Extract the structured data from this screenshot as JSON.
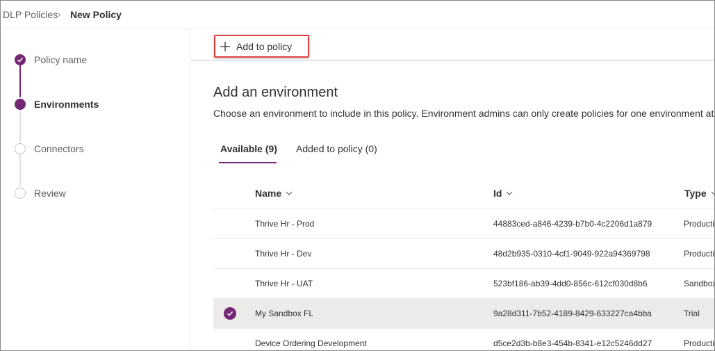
{
  "breadcrumb": {
    "root": "DLP Policies",
    "separator": "›",
    "current": "New Policy"
  },
  "steps": [
    {
      "label": "Policy name",
      "status": "completed"
    },
    {
      "label": "Environments",
      "status": "active"
    },
    {
      "label": "Connectors",
      "status": "pending"
    },
    {
      "label": "Review",
      "status": "pending"
    }
  ],
  "command_bar": {
    "add_label": "Add to policy"
  },
  "main": {
    "title": "Add an environment",
    "description": "Choose an environment to include in this policy. Environment admins can only create policies for one environment at"
  },
  "tabs": [
    {
      "label": "Available (9)",
      "selected": true
    },
    {
      "label": "Added to policy (0)",
      "selected": false
    }
  ],
  "table": {
    "columns": [
      "Name",
      "Id",
      "Type"
    ],
    "rows": [
      {
        "name": "Thrive Hr - Prod",
        "id": "44883ced-a846-4239-b7b0-4c2206d1a879",
        "type": "Production",
        "selected": false
      },
      {
        "name": "Thrive Hr - Dev",
        "id": "48d2b935-0310-4cf1-9049-922a94369798",
        "type": "Production",
        "selected": false
      },
      {
        "name": "Thrive Hr - UAT",
        "id": "523bf186-ab39-4dd0-856c-612cf030d8b6",
        "type": "Sandbox",
        "selected": false
      },
      {
        "name": "My Sandbox FL",
        "id": "9a28d311-7b52-4189-8429-633227ca4bba",
        "type": "Trial",
        "selected": true
      },
      {
        "name": "Device Ordering Development",
        "id": "d5ce2d3b-b8e3-454b-8341-e12c5246dd27",
        "type": "Production",
        "selected": false
      }
    ]
  },
  "colors": {
    "accent": "#742774",
    "highlight_border": "#e04040",
    "selected_row": "#edebe9"
  },
  "icons": {
    "add": "plus-icon",
    "completed_step": "checkmark-icon",
    "sort": "chevron-down-icon",
    "row_selected": "checkmark-circle-icon"
  }
}
